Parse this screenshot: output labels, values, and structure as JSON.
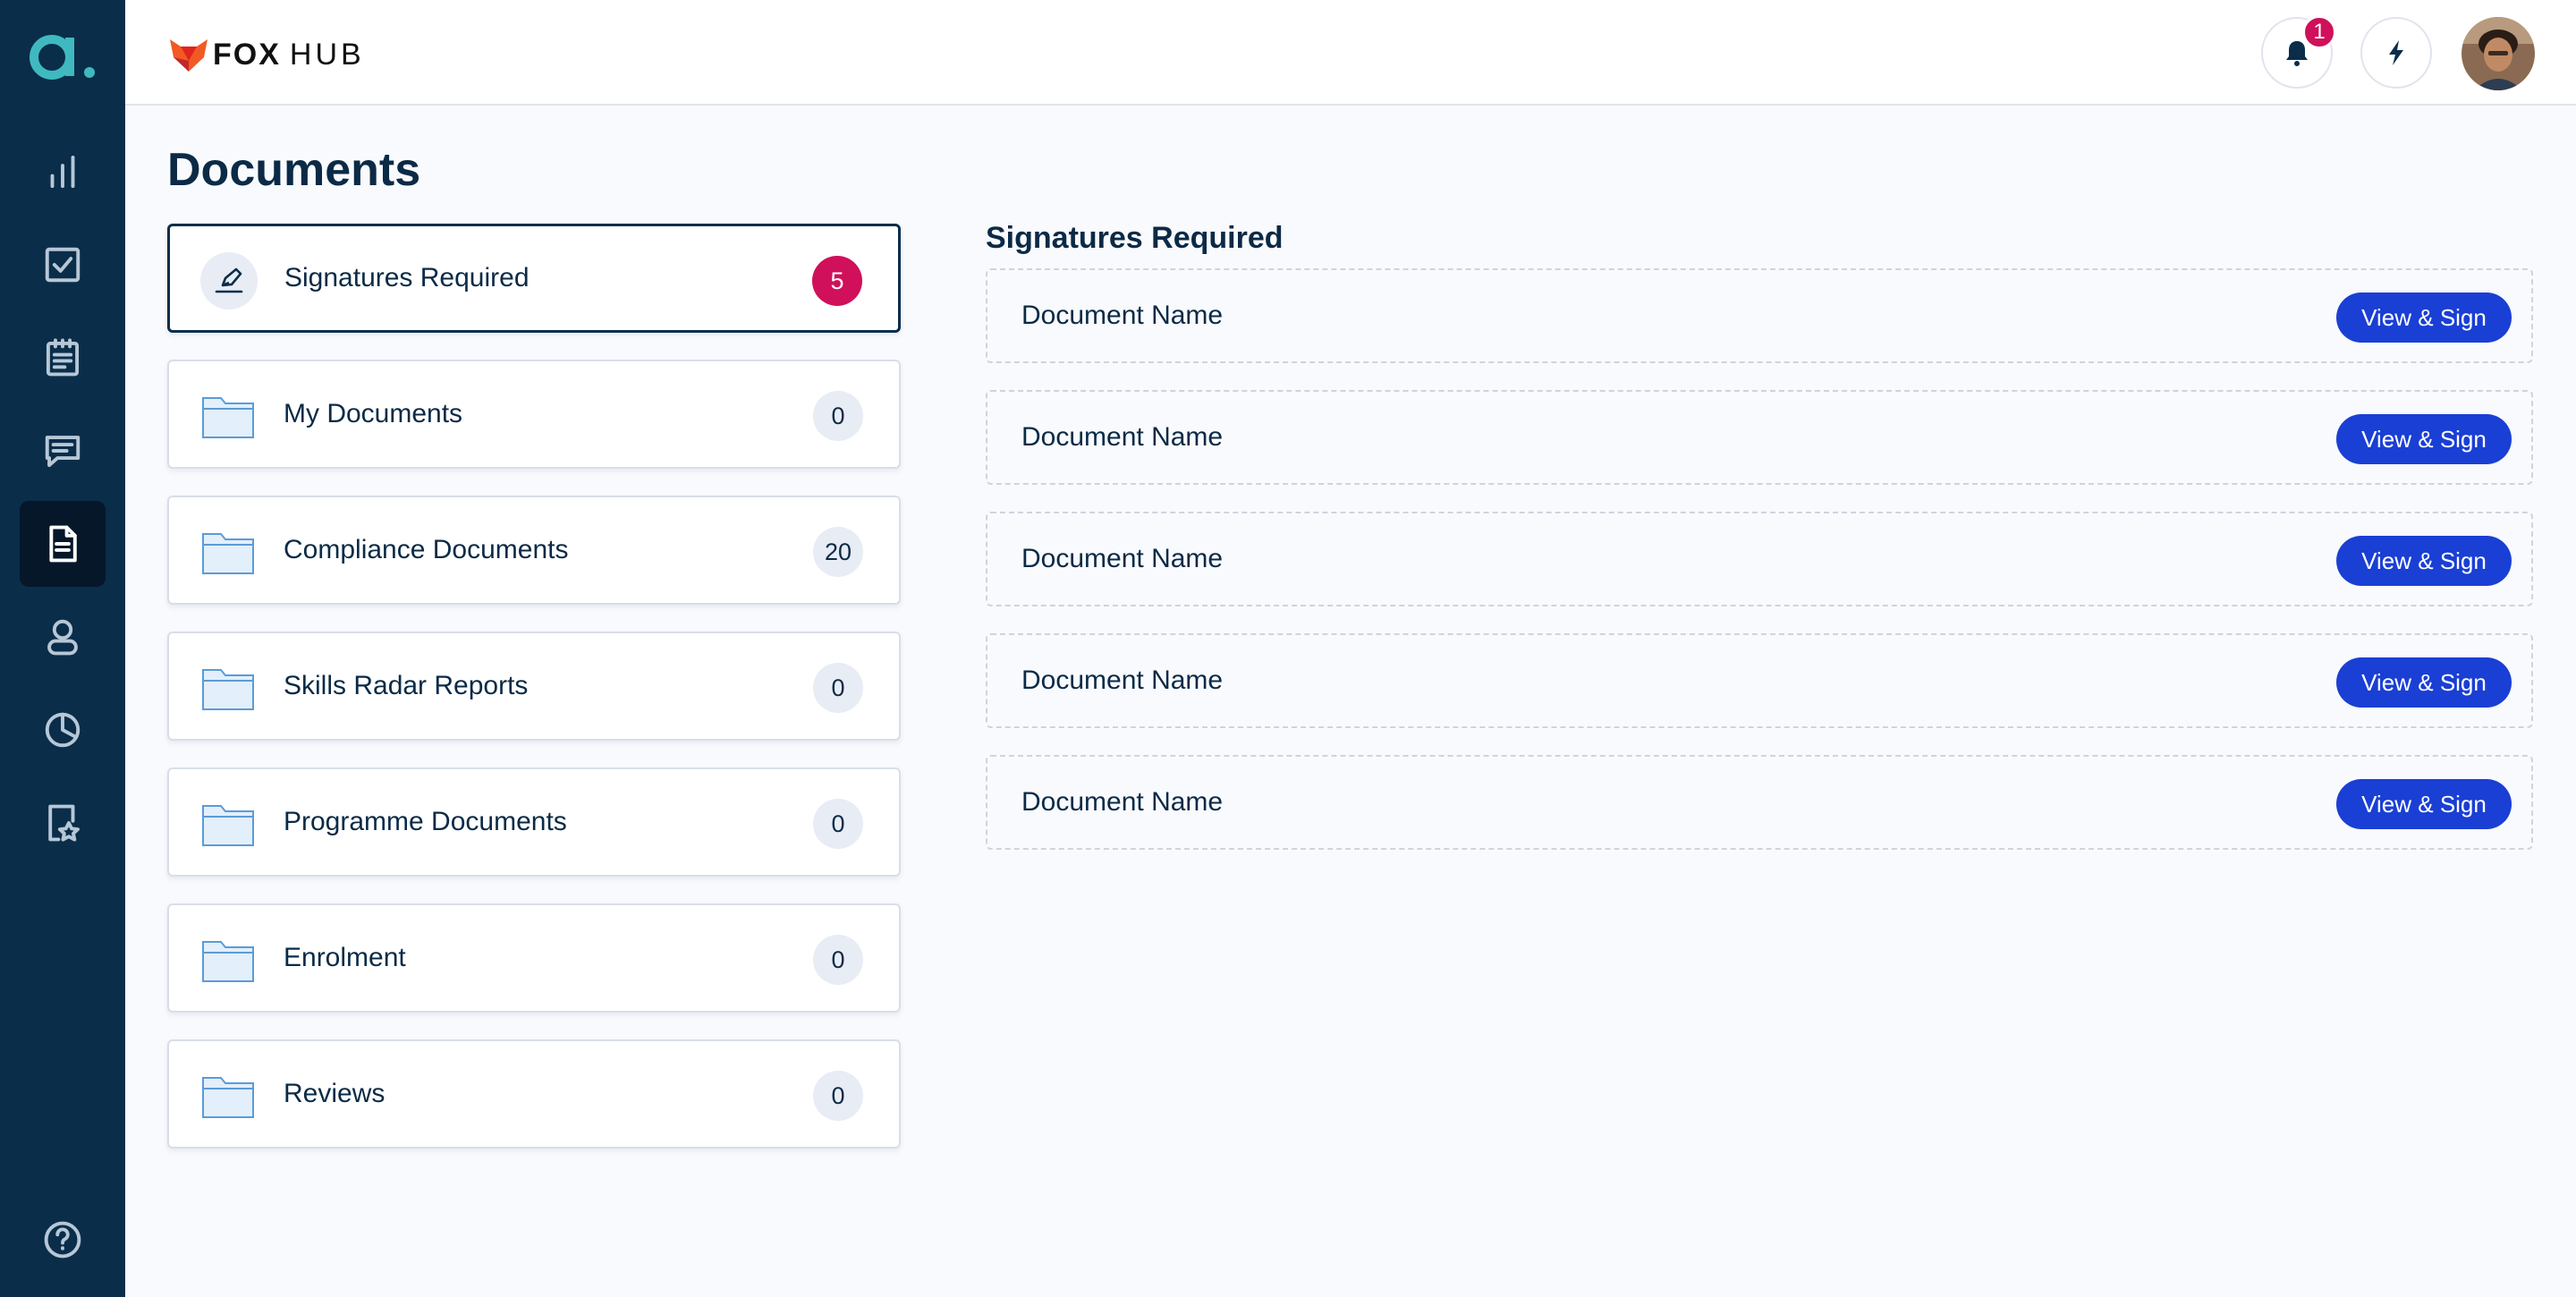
{
  "header": {
    "brand_fox": "FOX",
    "brand_hub": "HUB",
    "notification_count": "1"
  },
  "sidebar": {
    "logo": "a.",
    "items": [
      {
        "icon": "bar-chart-icon"
      },
      {
        "icon": "checkbox-icon"
      },
      {
        "icon": "clipboard-icon"
      },
      {
        "icon": "chat-icon"
      },
      {
        "icon": "document-icon",
        "active": true
      },
      {
        "icon": "user-icon"
      },
      {
        "icon": "pie-chart-icon"
      },
      {
        "icon": "badge-star-icon"
      }
    ],
    "help_icon": "help-icon"
  },
  "page": {
    "title": "Documents"
  },
  "folders": [
    {
      "label": "Signatures Required",
      "count": "5",
      "active": true
    },
    {
      "label": "My Documents",
      "count": "0"
    },
    {
      "label": "Compliance Documents",
      "count": "20"
    },
    {
      "label": "Skills Radar Reports",
      "count": "0"
    },
    {
      "label": "Programme Documents",
      "count": "0"
    },
    {
      "label": "Enrolment",
      "count": "0"
    },
    {
      "label": "Reviews",
      "count": "0"
    }
  ],
  "signatures": {
    "title": "Signatures Required",
    "documents": [
      {
        "name": "Document Name",
        "action": "View & Sign"
      },
      {
        "name": "Document Name",
        "action": "View & Sign"
      },
      {
        "name": "Document Name",
        "action": "View & Sign"
      },
      {
        "name": "Document Name",
        "action": "View & Sign"
      },
      {
        "name": "Document Name",
        "action": "View & Sign"
      }
    ]
  },
  "colors": {
    "sidebar": "#0a2d4a",
    "accent": "#1a3fd4",
    "alert": "#d0105a",
    "logo_teal": "#3fb9bf"
  }
}
